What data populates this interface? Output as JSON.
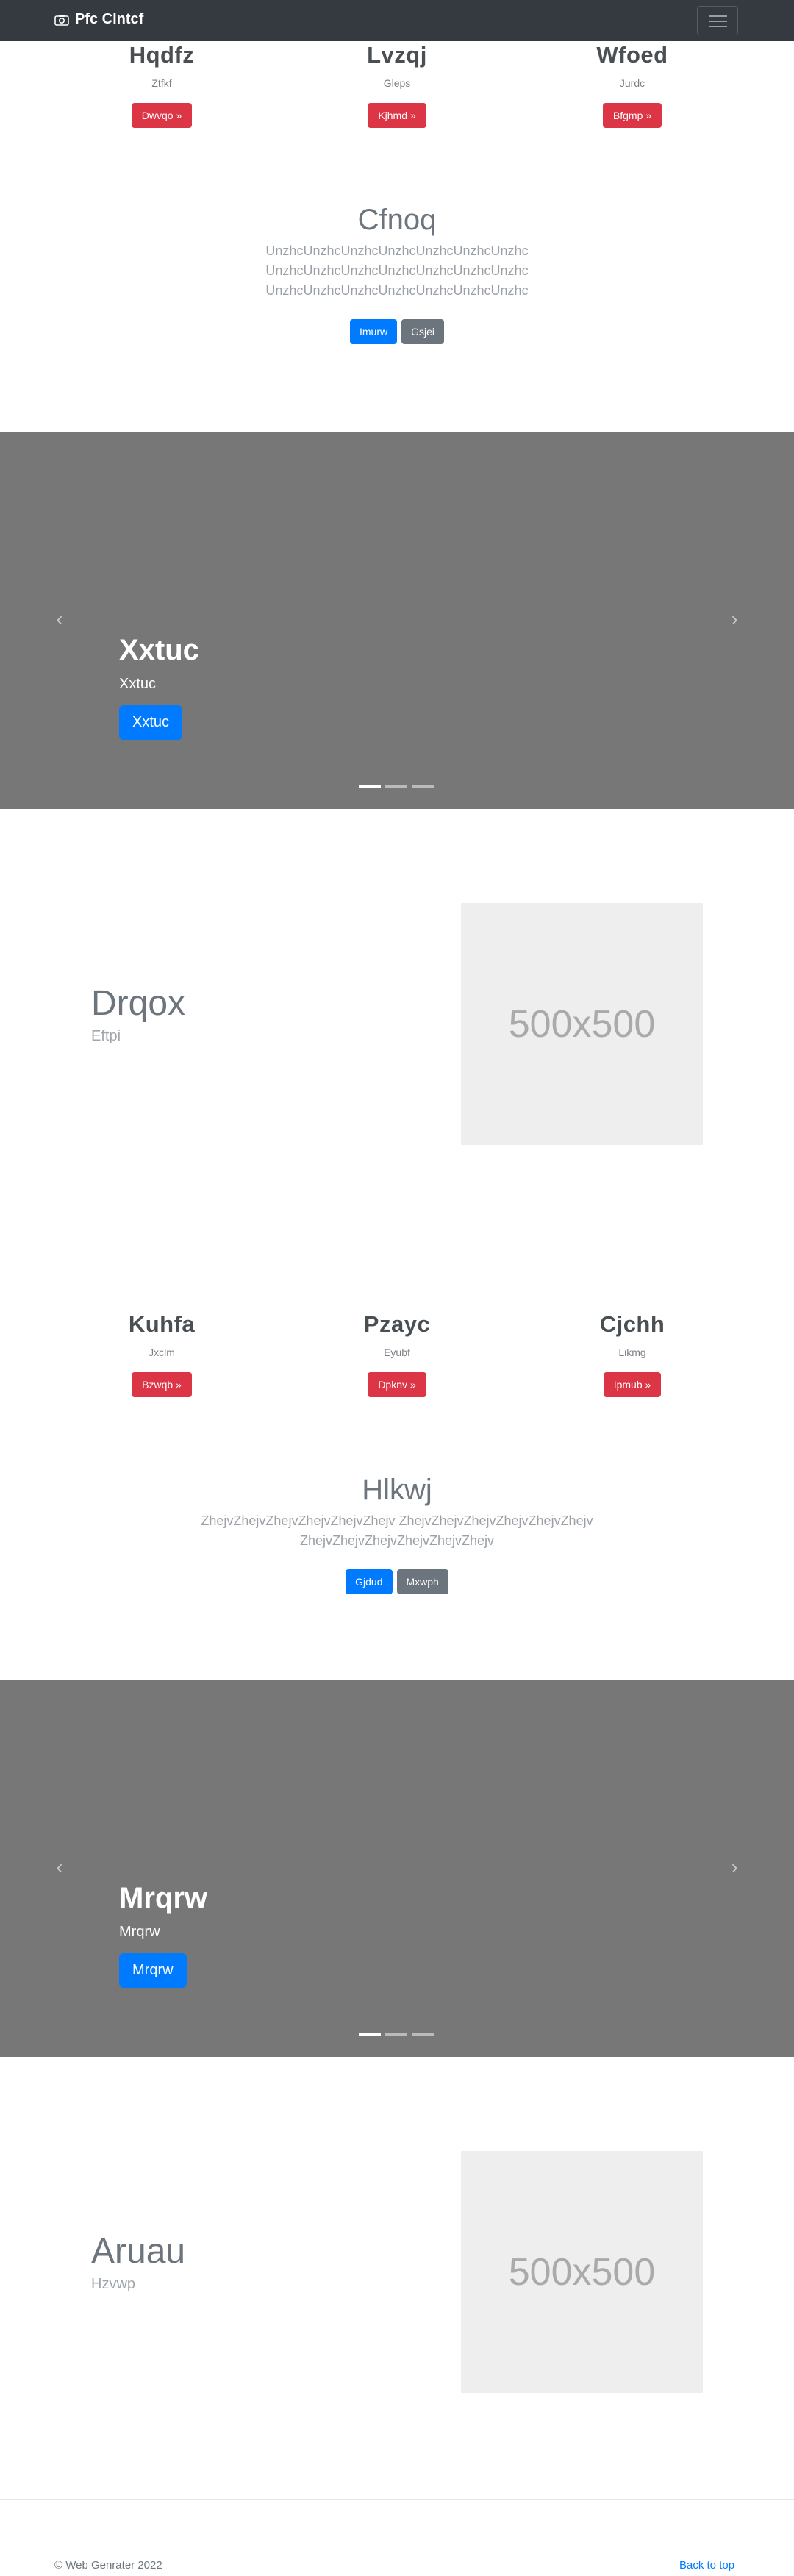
{
  "navbar": {
    "brand": "Pfc Clntcf",
    "brand_icon": "camera-icon",
    "toggler_icon": "hamburger-icon"
  },
  "section1": {
    "columns": [
      {
        "title": "Hqdfz",
        "text": "Ztfkf",
        "button": "Dwvqo »"
      },
      {
        "title": "Lvzqj",
        "text": "Gleps",
        "button": "Kjhmd »"
      },
      {
        "title": "Wfoed",
        "text": "Jurdc",
        "button": "Bfgmp »"
      }
    ],
    "heading": "Cfnoq",
    "lead": "UnzhcUnzhcUnzhcUnzhcUnzhcUnzhcUnzhc UnzhcUnzhcUnzhcUnzhcUnzhcUnzhcUnzhc UnzhcUnzhcUnzhcUnzhcUnzhcUnzhcUnzhc",
    "primary_button": "Imurw",
    "secondary_button": "Gsjei"
  },
  "carousel1": {
    "title": "Xxtuc",
    "text": "Xxtuc",
    "button": "Xxtuc",
    "prev_icon": "chevron-left-icon",
    "next_icon": "chevron-right-icon"
  },
  "featurette1": {
    "title": "Drqox",
    "subtitle": "Eftpi",
    "image_label": "500x500"
  },
  "section2": {
    "columns": [
      {
        "title": "Kuhfa",
        "text": "Jxclm",
        "button": "Bzwqb »"
      },
      {
        "title": "Pzayc",
        "text": "Eyubf",
        "button": "Dpknv »"
      },
      {
        "title": "Cjchh",
        "text": "Likmg",
        "button": "Ipmub »"
      }
    ],
    "heading": "Hlkwj",
    "lead": "ZhejvZhejvZhejvZhejvZhejvZhejv ZhejvZhejvZhejvZhejvZhejvZhejv ZhejvZhejvZhejvZhejvZhejvZhejv",
    "primary_button": "Gjdud",
    "secondary_button": "Mxwph"
  },
  "carousel2": {
    "title": "Mrqrw",
    "text": "Mrqrw",
    "button": "Mrqrw",
    "prev_icon": "chevron-left-icon",
    "next_icon": "chevron-right-icon"
  },
  "featurette2": {
    "title": "Aruau",
    "subtitle": "Hzvwp",
    "image_label": "500x500"
  },
  "footer": {
    "copyright": "© Web Genrater 2022",
    "back_to_top": "Back to top"
  },
  "colors": {
    "navbar": "#343a40",
    "danger": "#dc3545",
    "primary": "#007bff",
    "secondary": "#6c757d",
    "carousel": "#777777"
  }
}
